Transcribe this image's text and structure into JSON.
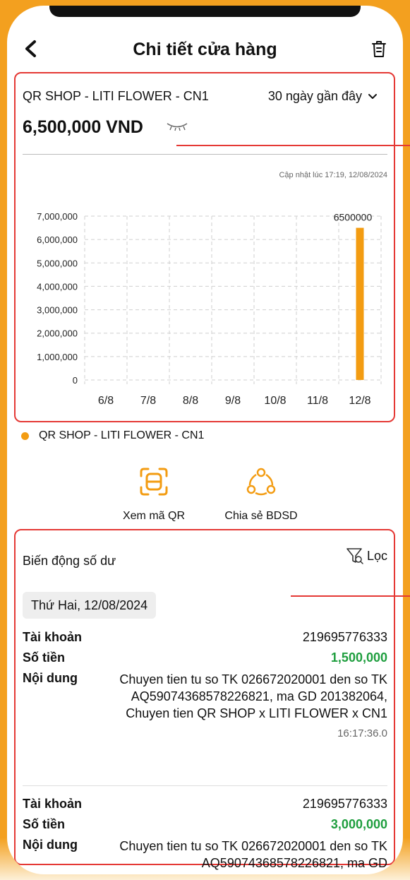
{
  "header": {
    "title": "Chi tiết cửa hàng"
  },
  "summary": {
    "shop_name": "QR SHOP - LITI FLOWER - CN1",
    "period": "30 ngày gần đây",
    "amount": "6,500,000 VND",
    "updated": "Cập nhật lúc 17:19, 12/08/2024"
  },
  "chart_data": {
    "type": "bar",
    "categories": [
      "6/8",
      "7/8",
      "8/8",
      "9/8",
      "10/8",
      "11/8",
      "12/8"
    ],
    "series": [
      {
        "name": "QR SHOP - LITI FLOWER - CN1",
        "values": [
          0,
          0,
          0,
          0,
          0,
          0,
          6500000
        ]
      }
    ],
    "ylim": [
      0,
      7000000
    ],
    "yticks": [
      "0",
      "1,000,000",
      "2,000,000",
      "3,000,000",
      "4,000,000",
      "5,000,000",
      "6,000,000",
      "7,000,000"
    ],
    "data_labels": [
      "6500000"
    ],
    "grid": true,
    "bar_color": "#f39c12"
  },
  "legend": {
    "label": "QR SHOP - LITI FLOWER - CN1"
  },
  "actions": {
    "qr_label": "Xem mã QR",
    "share_label": "Chia sẻ BDSD"
  },
  "bdsd": {
    "title": "Biến động số dư",
    "filter_label": "Lọc",
    "date": "Thứ Hai, 12/08/2024",
    "labels": {
      "account": "Tài khoản",
      "amount": "Số tiền",
      "content": "Nội dung"
    },
    "transactions": [
      {
        "account": "219695776333",
        "amount": "1,500,000",
        "content": "Chuyen tien tu so TK 026672020001 den so TK AQ59074368578226821, ma GD 201382064, Chuyen tien QR SHOP x LITI FLOWER x CN1",
        "time": "16:17:36.0"
      },
      {
        "account": "219695776333",
        "amount": "3,000,000",
        "content": "Chuyen tien tu so TK 026672020001 den so TK AQ59074368578226821, ma GD"
      }
    ]
  },
  "colors": {
    "accent": "#f3a01f",
    "highlight": "#e53935",
    "positive": "#1e9e3e",
    "bar": "#f39c12"
  }
}
